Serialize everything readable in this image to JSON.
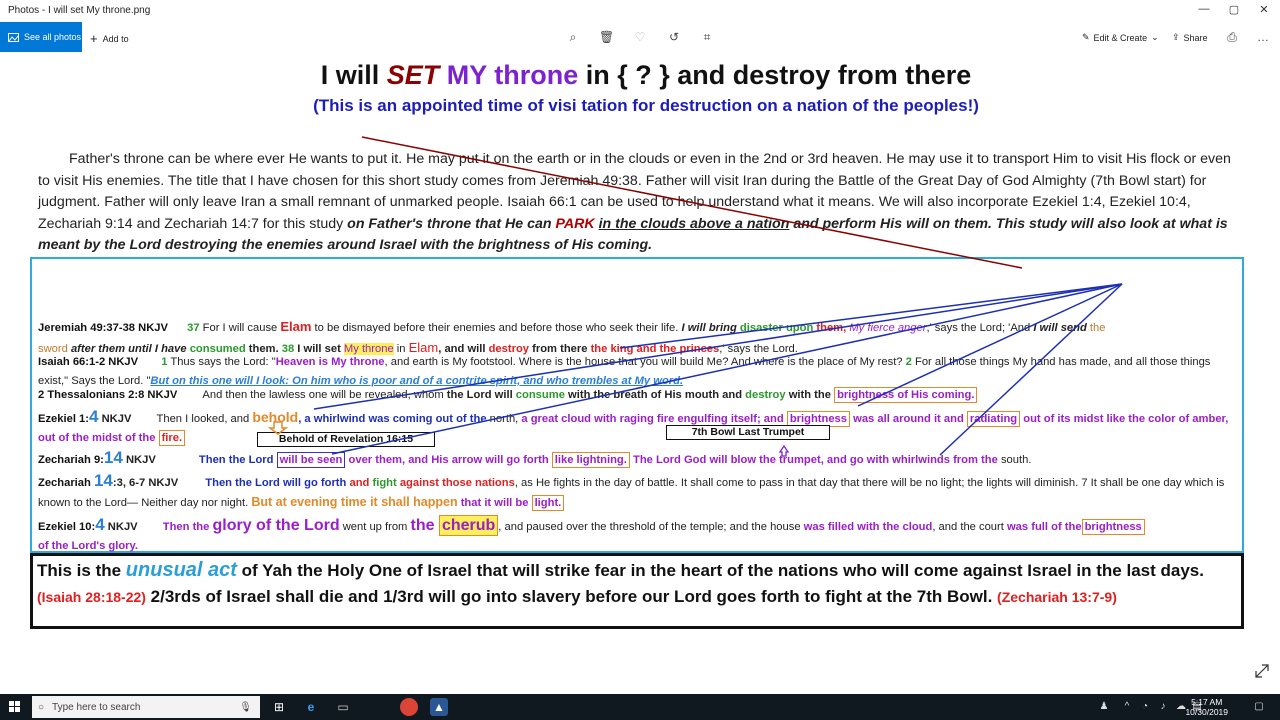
{
  "window": {
    "title": "Photos - I will set My throne.png",
    "minimize": "—",
    "maximize": "▢",
    "close": "✕"
  },
  "toolbar": {
    "see_all": "See all photos",
    "add_to": "Add to",
    "edit_create": "Edit & Create",
    "share": "Share"
  },
  "doc": {
    "title": {
      "part1": "I will ",
      "set": "SET",
      "my": " MY throne",
      "part2": " in {   ?   } and destroy from there"
    },
    "subtitle": "(This is an appointed time of visi tation for destruction on a nation of the peoples!)",
    "para_plain": "Father's throne can be where ever He wants to put it. He may  put it on the earth or in the clouds or even in the 2nd or 3rd heaven. He may use it to transport Him to visit His flock or even to visit His enemies. The title that I have chosen for this short study comes from Jeremiah 49:38. Father will visit Iran during the Battle of the Great Day of God Almighty (7th Bowl start) for judgment. Father will only leave Iran a small remnant of unmarked people. Isaiah 66:1 can be used to help understand what it means. We will also incorporate Ezekiel 1:4, Ezekiel 10:4, Zechariah 9:14 and Zechariah 14:7 for this study ",
    "para_bold1": "on Father's throne that He can ",
    "para_park": "PARK",
    "para_bold2": " ",
    "para_ul": "in the clouds above a nation",
    "para_bold3": " and perform His will on them. This study will also look at what is meant by the Lord destroying the enemies around Israel with the brightness of His coming.",
    "rows": {
      "jer_ref": "Jeremiah 49:37-38 NKJV",
      "jer_v37": "37",
      "jer_t1": " For I will cause ",
      "jer_elam": "Elam",
      "jer_t2": " to be dismayed before their enemies and before those who seek their life. ",
      "jer_iwillbring": "I will bring",
      "jer_disaster": " disaster upon",
      "jer_them": " them, ",
      "jer_fierce": "My fierce anger",
      "jer_t3": ",' says the Lord; 'And ",
      "jer_send": "I will send",
      "jer_the": " the",
      "jer_sword": "sword",
      "jer_after": " after them until I have ",
      "jer_consumed": "consumed",
      "jer_them2": " them. ",
      "jer_v38": "38",
      "jer_iwillset": " I will set ",
      "jer_mythrone": "My throne",
      "jer_in": " in ",
      "jer_elam2": "Elam",
      "jer_andwill": ", and will ",
      "jer_destroy": "destroy",
      "jer_fromthere": " from there ",
      "jer_king": "the king and the princes",
      "jer_end": ",' says the Lord.",
      "isa_ref": "Isaiah 66:1-2 NKJV",
      "isa_v1": "1",
      "isa_t1": " Thus says the Lord: \"",
      "isa_heaven": "Heaven is My throne",
      "isa_t2": ", and earth is My footstool. Where is the house that you will build Me? And where is the place of My rest? ",
      "isa_v2": "2",
      "isa_t3": " For all those things My hand has made, and all those things exist,\" Says the Lord. \"",
      "isa_look": "But on this one will I look: On him who is poor and of a contrite spirit, and who trembles at My word.",
      "thes_ref": "2 Thessalonians 2:8 NKJV",
      "thes_t1": "And then the lawless one will be revealed, whom ",
      "thes_lord": "the Lord will ",
      "thes_consume": "consume",
      "thes_t2": " with the breath of His mouth and ",
      "thes_destroy": "destroy",
      "thes_t3": " with the ",
      "thes_bright": "brightness of His coming.",
      "ez1_ref": "Ezekiel 1:",
      "ez1_num": "4",
      "ez1_nkjv": " NKJV",
      "ez1_t1": "Then I looked, and ",
      "ez1_behold": "behold",
      "ez1_t2": ", a whirlwind was coming out of the",
      "ez1_north": " north, ",
      "ez1_t3": "a great cloud with raging fire engulfing itself; and ",
      "ez1_bright": "brightness",
      "ez1_t4": " was all around it and ",
      "ez1_rad": "radiating",
      "ez1_t5": " out of its midst like the color of amber, out of the midst of the ",
      "ez1_fire": "fire.",
      "lbl_behold": "Behold of Revelation 16:15",
      "lbl_bowl": "7th Bowl Last Trumpet",
      "zec9_ref": "Zechariah 9:",
      "zec9_num": "14",
      "zec9_nkjv": " NKJV",
      "zec9_t1": "Then the Lord ",
      "zec9_seen": "will be seen",
      "zec9_t2": " over them, and His arrow will go forth ",
      "zec9_light": "like lightning.",
      "zec9_t3": " The Lord God will blow the trumpet, and go with whirlwinds from the ",
      "zec9_south": "south.",
      "zec14_ref": "Zechariah ",
      "zec14_num": "14",
      "zec14_rest": ":3, 6-7 NKJV",
      "zec14_t1": "Then the Lord ",
      "zec14_goforth": "will go forth",
      "zec14_and": " and ",
      "zec14_fight": "fight",
      "zec14_t2": " against those nations",
      "zec14_t3": ", as He fights in the day of battle. It shall come to pass in that day that there will be no light; the lights will diminish. 7 It shall be one day which is known to the Lord— Neither day nor night. ",
      "zec14_evening": "But at evening time it shall happen",
      "zec14_t4": " that it will be ",
      "zec14_lightw": "light.",
      "ez10_ref": "Ezekiel 10:",
      "ez10_num": "4",
      "ez10_nkjv": " NKJV",
      "ez10_t1": "Then the ",
      "ez10_glory": "glory of the Lord",
      "ez10_t2": " went up from ",
      "ez10_the": "the ",
      "ez10_cherub": "cherub",
      "ez10_t3": ", and paused over the threshold of the temple; and the house ",
      "ez10_filled": "was filled with the cloud",
      "ez10_t4": ", and the court ",
      "ez10_full": "was full of the",
      "ez10_bright": "brightness",
      "ez10_t5": " of the Lord's glory."
    },
    "box": {
      "t1": "This is the ",
      "unusual": "unusual act",
      "t2": " of Yah the Holy One of Israel that will strike fear in the heart of the nations who will come against Israel in the last days. ",
      "ref1": "(Isaiah 28:18-22)",
      "t3": " 2/3rds of Israel shall die and 1/3rd will go into slavery before our Lord goes forth to fight at the 7th Bowl. ",
      "ref2": "(Zechariah 13:7-9)"
    }
  },
  "taskbar": {
    "search_placeholder": "Type here to search",
    "time": "5:17 AM",
    "date": "10/30/2019"
  },
  "colors": {
    "accent": "#0078d7",
    "cyan_border": "#2eaadc",
    "dark_red_line": "#8b0000",
    "blue_line": "#1c2fb5"
  }
}
